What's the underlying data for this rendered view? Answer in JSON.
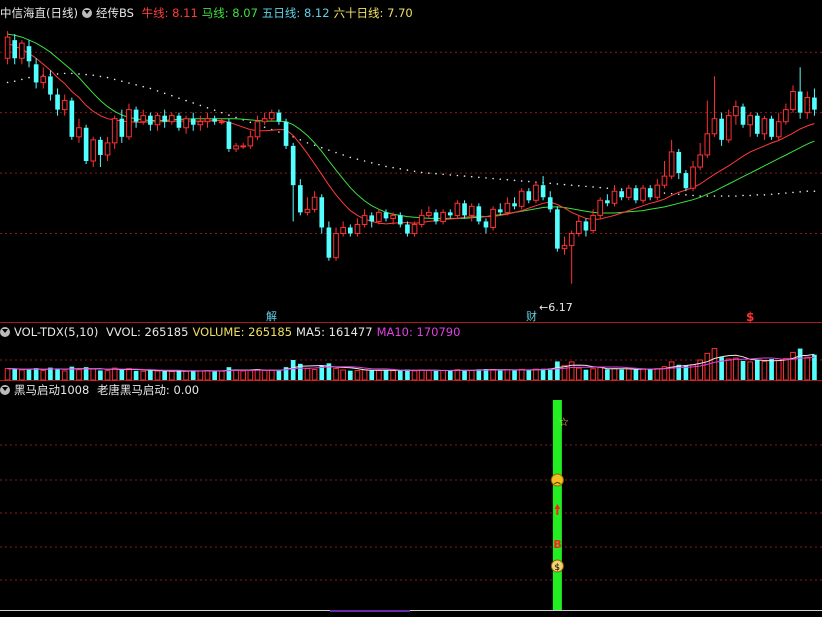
{
  "main_header": {
    "stock_name": "中信海直(日线)",
    "indicator_name": "经传BS",
    "items": [
      {
        "label": "牛线:",
        "value": "8.11",
        "color": "#ff3b3b"
      },
      {
        "label": "马线:",
        "value": "8.07",
        "color": "#3ee03e"
      },
      {
        "label": "五日线:",
        "value": "8.12",
        "color": "#5fd3e6"
      },
      {
        "label": "六十日线:",
        "value": "7.70",
        "color": "#f0e060"
      }
    ]
  },
  "vol_header": {
    "name": "VOL-TDX(5,10)",
    "items": [
      {
        "label": "VVOL:",
        "value": "265185",
        "color": "#e8e8e8"
      },
      {
        "label": "VOLUME:",
        "value": "265185",
        "color": "#f0e060"
      },
      {
        "label": "MA5:",
        "value": "161477",
        "color": "#e8e8e8"
      },
      {
        "label": "MA10:",
        "value": "170790",
        "color": "#e040e0"
      }
    ]
  },
  "ind_header": {
    "name": "黑马启动1008",
    "items": [
      {
        "label": "老唐黑马启动:",
        "value": "0.00",
        "color": "#e8e8e8"
      }
    ]
  },
  "annotations": {
    "low_price_label": "←6.17",
    "marker_jie": "解",
    "marker_cai": "财",
    "marker_dollar": "$",
    "signal_b": "B"
  },
  "colors": {
    "up": "#ff3030",
    "down": "#54ffff",
    "ma_red": "#ff3b3b",
    "ma_green": "#3ee03e",
    "ma_white": "#e8e8e8",
    "ma_magenta": "#e040e0",
    "grid": "#8a1c1c",
    "signal_bar": "#22ee22"
  },
  "chart_data": {
    "type": "candlestick",
    "price_ylim": [
      5.9,
      10.5
    ],
    "volume_ylim": [
      0,
      420000
    ],
    "low_annotation_value": 6.17,
    "candles": [
      [
        9.9,
        10.25,
        10.35,
        9.8
      ],
      [
        10.2,
        9.9,
        10.3,
        9.8
      ],
      [
        9.9,
        10.15,
        10.2,
        9.8
      ],
      [
        10.1,
        9.85,
        10.2,
        9.75
      ],
      [
        9.8,
        9.5,
        9.9,
        9.4
      ],
      [
        9.5,
        9.6,
        9.75,
        9.4
      ],
      [
        9.6,
        9.3,
        9.7,
        9.2
      ],
      [
        9.3,
        9.05,
        9.4,
        8.95
      ],
      [
        9.05,
        9.2,
        9.3,
        8.95
      ],
      [
        9.2,
        8.6,
        9.25,
        8.55
      ],
      [
        8.6,
        8.75,
        8.9,
        8.5
      ],
      [
        8.75,
        8.2,
        8.8,
        8.15
      ],
      [
        8.2,
        8.55,
        8.6,
        8.1
      ],
      [
        8.55,
        8.3,
        8.6,
        8.1
      ],
      [
        8.3,
        8.5,
        8.6,
        8.2
      ],
      [
        8.5,
        8.9,
        8.95,
        8.4
      ],
      [
        8.9,
        8.6,
        9.05,
        8.5
      ],
      [
        8.6,
        9.05,
        9.15,
        8.55
      ],
      [
        9.05,
        8.85,
        9.1,
        8.75
      ],
      [
        8.85,
        8.95,
        9.05,
        8.8
      ],
      [
        8.95,
        8.8,
        9.0,
        8.7
      ],
      [
        8.8,
        8.95,
        9.0,
        8.7
      ],
      [
        8.95,
        8.85,
        9.05,
        8.75
      ],
      [
        8.85,
        8.95,
        9.0,
        8.8
      ],
      [
        8.95,
        8.75,
        9.0,
        8.7
      ],
      [
        8.75,
        8.9,
        8.95,
        8.65
      ],
      [
        8.9,
        8.8,
        9.0,
        8.7
      ],
      [
        8.8,
        8.85,
        8.95,
        8.7
      ],
      [
        8.85,
        8.9,
        9.0,
        8.75
      ],
      [
        8.9,
        8.85,
        8.95,
        8.8
      ],
      [
        8.85,
        8.85,
        8.9,
        8.8
      ],
      [
        8.85,
        8.4,
        8.9,
        8.35
      ],
      [
        8.4,
        8.45,
        8.5,
        8.35
      ],
      [
        8.45,
        8.45,
        8.5,
        8.4
      ],
      [
        8.45,
        8.6,
        8.7,
        8.4
      ],
      [
        8.6,
        8.85,
        8.95,
        8.55
      ],
      [
        8.85,
        8.9,
        9.0,
        8.8
      ],
      [
        8.9,
        9.0,
        9.05,
        8.85
      ],
      [
        9.0,
        8.85,
        9.05,
        8.8
      ],
      [
        8.85,
        8.45,
        8.9,
        8.4
      ],
      [
        8.45,
        7.8,
        8.5,
        7.2
      ],
      [
        7.8,
        7.35,
        7.9,
        7.3
      ],
      [
        7.35,
        7.4,
        7.6,
        7.3
      ],
      [
        7.4,
        7.6,
        7.7,
        7.35
      ],
      [
        7.6,
        7.1,
        7.65,
        7.0
      ],
      [
        7.1,
        6.6,
        7.2,
        6.55
      ],
      [
        6.6,
        7.0,
        7.1,
        6.55
      ],
      [
        7.0,
        7.1,
        7.2,
        6.95
      ],
      [
        7.1,
        7.0,
        7.15,
        6.95
      ],
      [
        7.0,
        7.15,
        7.25,
        6.95
      ],
      [
        7.15,
        7.3,
        7.4,
        7.1
      ],
      [
        7.3,
        7.2,
        7.35,
        7.1
      ],
      [
        7.2,
        7.35,
        7.4,
        7.15
      ],
      [
        7.35,
        7.25,
        7.4,
        7.2
      ],
      [
        7.25,
        7.3,
        7.35,
        7.15
      ],
      [
        7.3,
        7.15,
        7.35,
        7.1
      ],
      [
        7.15,
        7.0,
        7.2,
        6.95
      ],
      [
        7.0,
        7.15,
        7.2,
        6.95
      ],
      [
        7.15,
        7.3,
        7.4,
        7.1
      ],
      [
        7.3,
        7.35,
        7.45,
        7.25
      ],
      [
        7.35,
        7.2,
        7.4,
        7.15
      ],
      [
        7.2,
        7.35,
        7.4,
        7.15
      ],
      [
        7.35,
        7.3,
        7.4,
        7.25
      ],
      [
        7.3,
        7.5,
        7.55,
        7.25
      ],
      [
        7.5,
        7.3,
        7.55,
        7.25
      ],
      [
        7.3,
        7.45,
        7.5,
        7.2
      ],
      [
        7.45,
        7.2,
        7.5,
        7.15
      ],
      [
        7.2,
        7.1,
        7.25,
        7.0
      ],
      [
        7.1,
        7.4,
        7.45,
        7.05
      ],
      [
        7.4,
        7.35,
        7.5,
        7.3
      ],
      [
        7.35,
        7.5,
        7.6,
        7.3
      ],
      [
        7.5,
        7.45,
        7.6,
        7.4
      ],
      [
        7.45,
        7.7,
        7.75,
        7.4
      ],
      [
        7.7,
        7.55,
        7.75,
        7.5
      ],
      [
        7.55,
        7.8,
        7.85,
        7.5
      ],
      [
        7.8,
        7.6,
        7.95,
        7.55
      ],
      [
        7.6,
        7.4,
        7.7,
        7.35
      ],
      [
        7.4,
        6.75,
        7.45,
        6.7
      ],
      [
        6.75,
        6.8,
        6.95,
        6.65
      ],
      [
        6.8,
        7.0,
        7.05,
        6.17
      ],
      [
        7.0,
        7.2,
        7.3,
        6.95
      ],
      [
        7.2,
        7.05,
        7.25,
        6.95
      ],
      [
        7.05,
        7.3,
        7.4,
        7.0
      ],
      [
        7.3,
        7.55,
        7.6,
        7.25
      ],
      [
        7.55,
        7.5,
        7.65,
        7.45
      ],
      [
        7.5,
        7.7,
        7.8,
        7.45
      ],
      [
        7.7,
        7.6,
        7.75,
        7.55
      ],
      [
        7.6,
        7.75,
        7.8,
        7.55
      ],
      [
        7.75,
        7.55,
        7.8,
        7.5
      ],
      [
        7.55,
        7.75,
        7.8,
        7.5
      ],
      [
        7.75,
        7.6,
        7.8,
        7.55
      ],
      [
        7.6,
        7.8,
        7.9,
        7.55
      ],
      [
        7.8,
        7.95,
        8.2,
        7.75
      ],
      [
        7.95,
        8.35,
        8.55,
        7.9
      ],
      [
        8.35,
        8.0,
        8.4,
        7.9
      ],
      [
        8.0,
        7.75,
        8.05,
        7.7
      ],
      [
        7.75,
        8.1,
        8.2,
        7.7
      ],
      [
        8.1,
        8.3,
        8.5,
        8.05
      ],
      [
        8.3,
        8.65,
        9.2,
        8.25
      ],
      [
        8.65,
        8.9,
        9.6,
        8.6
      ],
      [
        8.9,
        8.55,
        9.0,
        8.45
      ],
      [
        8.55,
        8.95,
        9.05,
        8.5
      ],
      [
        8.95,
        9.1,
        9.2,
        8.8
      ],
      [
        9.1,
        8.8,
        9.15,
        8.75
      ],
      [
        8.8,
        8.95,
        9.0,
        8.6
      ],
      [
        8.95,
        8.65,
        9.0,
        8.6
      ],
      [
        8.65,
        8.9,
        8.95,
        8.55
      ],
      [
        8.9,
        8.6,
        8.95,
        8.55
      ],
      [
        8.6,
        8.85,
        9.0,
        8.55
      ],
      [
        8.85,
        9.05,
        9.15,
        8.8
      ],
      [
        9.05,
        9.35,
        9.45,
        9.0
      ],
      [
        9.35,
        9.0,
        9.75,
        8.9
      ],
      [
        9.0,
        9.25,
        9.35,
        8.9
      ],
      [
        9.25,
        9.05,
        9.4,
        8.95
      ]
    ],
    "volumes": [
      120000,
      115000,
      105000,
      110000,
      125000,
      100000,
      130000,
      118000,
      95000,
      140000,
      108000,
      135000,
      115000,
      100000,
      98000,
      125000,
      110000,
      120000,
      96000,
      92000,
      99000,
      94000,
      96000,
      90000,
      98000,
      92000,
      100000,
      95000,
      97000,
      93000,
      92000,
      135000,
      105000,
      95000,
      100000,
      110000,
      100000,
      104000,
      99000,
      135000,
      210000,
      170000,
      120000,
      110000,
      150000,
      175000,
      120000,
      105000,
      98000,
      100000,
      108000,
      104000,
      100000,
      102000,
      98000,
      100000,
      110000,
      96000,
      104000,
      100000,
      98000,
      100000,
      96000,
      108000,
      102000,
      100000,
      112000,
      115000,
      110000,
      100000,
      106000,
      100000,
      112000,
      108000,
      114000,
      118000,
      120000,
      195000,
      150000,
      190000,
      125000,
      108000,
      118000,
      130000,
      112000,
      120000,
      110000,
      115000,
      112000,
      118000,
      110000,
      120000,
      140000,
      190000,
      160000,
      150000,
      160000,
      210000,
      280000,
      330000,
      240000,
      220000,
      230000,
      200000,
      190000,
      210000,
      195000,
      220000,
      205000,
      225000,
      290000,
      330000,
      240000,
      265185
    ],
    "ma_red": [
      10.15,
      10.1,
      10.05,
      9.98,
      9.9,
      9.8,
      9.7,
      9.58,
      9.48,
      9.35,
      9.25,
      9.12,
      9.02,
      8.95,
      8.9,
      8.88,
      8.86,
      8.85,
      8.84,
      8.84,
      8.85,
      8.85,
      8.85,
      8.86,
      8.86,
      8.86,
      8.86,
      8.86,
      8.86,
      8.87,
      8.87,
      8.84,
      8.8,
      8.76,
      8.72,
      8.7,
      8.7,
      8.71,
      8.72,
      8.72,
      8.62,
      8.48,
      8.32,
      8.15,
      7.98,
      7.8,
      7.64,
      7.5,
      7.38,
      7.3,
      7.24,
      7.2,
      7.17,
      7.16,
      7.17,
      7.18,
      7.18,
      7.17,
      7.18,
      7.2,
      7.21,
      7.23,
      7.24,
      7.25,
      7.27,
      7.28,
      7.29,
      7.28,
      7.28,
      7.3,
      7.32,
      7.35,
      7.38,
      7.42,
      7.46,
      7.5,
      7.52,
      7.48,
      7.42,
      7.35,
      7.3,
      7.25,
      7.23,
      7.24,
      7.27,
      7.3,
      7.34,
      7.38,
      7.42,
      7.46,
      7.5,
      7.53,
      7.57,
      7.63,
      7.68,
      7.72,
      7.76,
      7.82,
      7.9,
      7.98,
      8.05,
      8.12,
      8.2,
      8.28,
      8.35,
      8.4,
      8.45,
      8.5,
      8.54,
      8.6,
      8.66,
      8.73,
      8.78,
      8.82
    ],
    "ma_green": [
      10.3,
      10.28,
      10.25,
      10.2,
      10.15,
      10.08,
      10.0,
      9.9,
      9.8,
      9.7,
      9.58,
      9.45,
      9.32,
      9.2,
      9.1,
      9.02,
      8.96,
      8.92,
      8.9,
      8.88,
      8.87,
      8.87,
      8.87,
      8.88,
      8.89,
      8.89,
      8.9,
      8.9,
      8.9,
      8.9,
      8.9,
      8.9,
      8.9,
      8.89,
      8.88,
      8.87,
      8.86,
      8.86,
      8.86,
      8.85,
      8.8,
      8.72,
      8.62,
      8.5,
      8.36,
      8.2,
      8.05,
      7.9,
      7.76,
      7.64,
      7.54,
      7.46,
      7.4,
      7.35,
      7.32,
      7.3,
      7.28,
      7.27,
      7.26,
      7.25,
      7.25,
      7.25,
      7.25,
      7.25,
      7.25,
      7.26,
      7.27,
      7.28,
      7.3,
      7.31,
      7.33,
      7.35,
      7.37,
      7.39,
      7.41,
      7.43,
      7.44,
      7.44,
      7.43,
      7.41,
      7.39,
      7.37,
      7.35,
      7.34,
      7.34,
      7.34,
      7.35,
      7.36,
      7.37,
      7.38,
      7.4,
      7.42,
      7.44,
      7.47,
      7.5,
      7.53,
      7.56,
      7.6,
      7.65,
      7.7,
      7.76,
      7.82,
      7.88,
      7.94,
      8.0,
      8.06,
      8.12,
      8.18,
      8.24,
      8.3,
      8.36,
      8.42,
      8.48,
      8.53
    ],
    "ma_dotted_60": [
      9.5,
      9.52,
      9.55,
      9.58,
      9.6,
      9.62,
      9.63,
      9.64,
      9.65,
      9.65,
      9.64,
      9.63,
      9.62,
      9.6,
      9.58,
      9.55,
      9.52,
      9.49,
      9.46,
      9.43,
      9.4,
      9.36,
      9.32,
      9.28,
      9.24,
      9.2,
      9.16,
      9.12,
      9.08,
      9.04,
      9.0,
      8.96,
      8.92,
      8.88,
      8.84,
      8.8,
      8.76,
      8.72,
      8.68,
      8.64,
      8.6,
      8.55,
      8.5,
      8.46,
      8.42,
      8.38,
      8.34,
      8.3,
      8.26,
      8.23,
      8.2,
      8.17,
      8.14,
      8.11,
      8.09,
      8.07,
      8.05,
      8.03,
      8.01,
      8.0,
      7.99,
      7.98,
      7.97,
      7.96,
      7.95,
      7.94,
      7.93,
      7.92,
      7.91,
      7.9,
      7.89,
      7.88,
      7.87,
      7.86,
      7.85,
      7.84,
      7.83,
      7.82,
      7.81,
      7.8,
      7.79,
      7.78,
      7.77,
      7.76,
      7.75,
      7.74,
      7.73,
      7.72,
      7.71,
      7.7,
      7.69,
      7.68,
      7.67,
      7.66,
      7.65,
      7.64,
      7.63,
      7.62,
      7.62,
      7.62,
      7.62,
      7.62,
      7.62,
      7.63,
      7.63,
      7.64,
      7.64,
      7.65,
      7.66,
      7.67,
      7.68,
      7.69,
      7.7,
      7.7
    ],
    "signal_index": 77
  }
}
